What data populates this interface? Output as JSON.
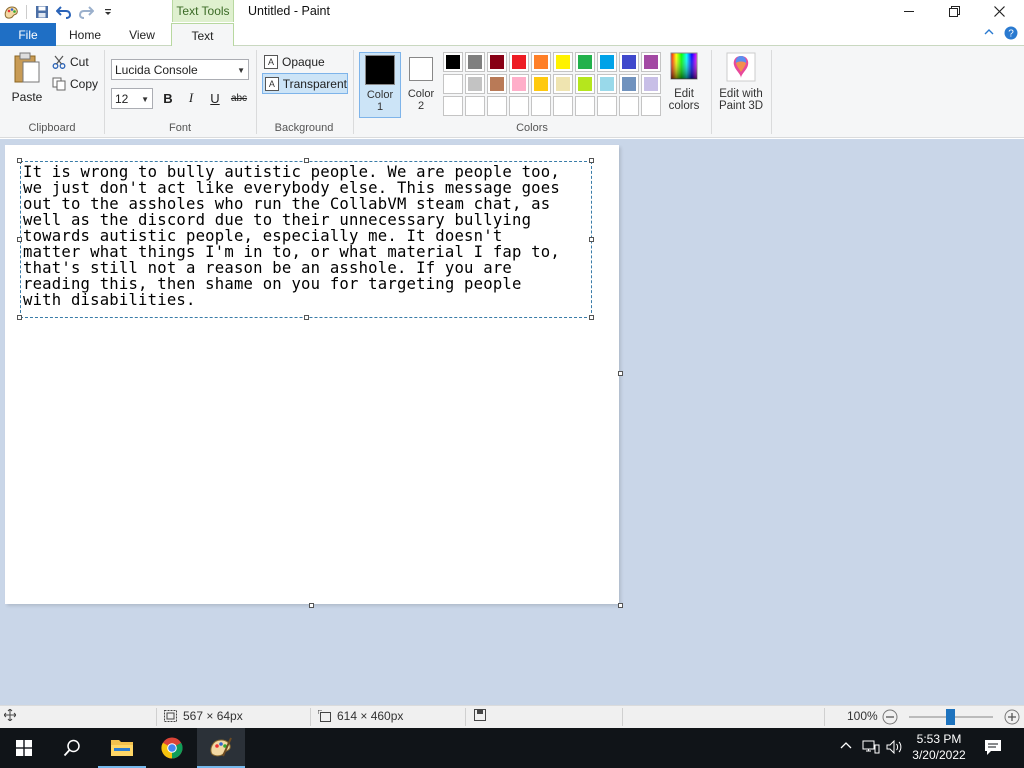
{
  "titlebar": {
    "context_tab": "Text Tools",
    "title": "Untitled - Paint"
  },
  "tabs": {
    "file": "File",
    "home": "Home",
    "view": "View",
    "text": "Text"
  },
  "ribbon": {
    "clipboard": {
      "paste": "Paste",
      "cut": "Cut",
      "copy": "Copy",
      "label": "Clipboard"
    },
    "font": {
      "family": "Lucida Console",
      "size": "12",
      "bold": "B",
      "italic": "I",
      "underline": "U",
      "strike": "abc",
      "label": "Font"
    },
    "background": {
      "opaque": "Opaque",
      "transparent": "Transparent",
      "label": "Background"
    },
    "colors": {
      "color1_label_a": "Color",
      "color1_label_b": "1",
      "color2_label_a": "Color",
      "color2_label_b": "2",
      "color1": "#000000",
      "color2": "#ffffff",
      "edit_colors_a": "Edit",
      "edit_colors_b": "colors",
      "label": "Colors",
      "palette": [
        "#000000",
        "#7f7f7f",
        "#880015",
        "#ed1c24",
        "#ff7f27",
        "#fff200",
        "#22b14c",
        "#00a2e8",
        "#3f48cc",
        "#a349a4",
        "#ffffff",
        "#c3c3c3",
        "#b97a57",
        "#ffaec9",
        "#ffc90e",
        "#efe4b0",
        "#b5e61d",
        "#99d9ea",
        "#7092be",
        "#c8bfe7",
        "",
        "",
        "",
        "",
        "",
        "",
        "",
        "",
        "",
        ""
      ]
    },
    "paint3d_a": "Edit with",
    "paint3d_b": "Paint 3D"
  },
  "canvas": {
    "text_lines": [
      "It is wrong to bully autistic people. We are people too,",
      "we just don't act like everybody else. This message goes",
      "out to the assholes who run the CollabVM steam chat, as",
      "well as the discord due to their unnecessary bullying",
      "towards autistic people, especially me. It doesn't",
      "matter what things I'm in to, or what material I fap to,",
      "that's still not a reason be an asshole. If you are",
      "reading this, then shame on you for targeting people",
      "with disabilities."
    ]
  },
  "status": {
    "selection_size": "567 × 64px",
    "image_size": "614 × 460px",
    "zoom": "100%"
  },
  "clock": {
    "time": "5:53 PM",
    "date": "3/20/2022"
  }
}
